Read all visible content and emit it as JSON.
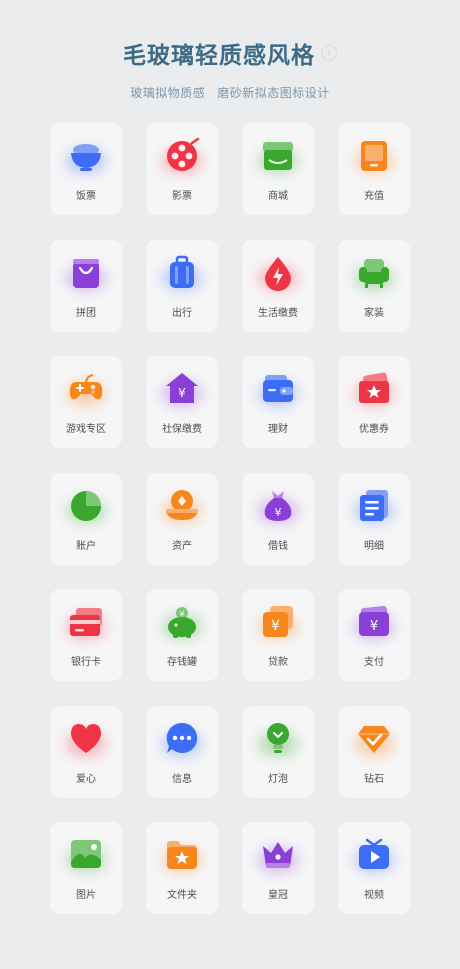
{
  "header": {
    "title": "毛玻璃轻质感风格",
    "badge": "!",
    "subtitle_1": "玻璃拟物质感",
    "subtitle_2": "磨砂新拟态图标设计"
  },
  "icons": [
    {
      "label": "饭票",
      "icon": "rice-bowl-icon",
      "color": "#3d6df5"
    },
    {
      "label": "影票",
      "icon": "film-reel-icon",
      "color": "#ee3546"
    },
    {
      "label": "商城",
      "icon": "shop-icon",
      "color": "#3aa72f"
    },
    {
      "label": "充值",
      "icon": "tablet-icon",
      "color": "#f7861d"
    },
    {
      "label": "拼团",
      "icon": "shopping-bag-icon",
      "color": "#8b3fd9"
    },
    {
      "label": "出行",
      "icon": "suitcase-icon",
      "color": "#3d6df5"
    },
    {
      "label": "生活缴费",
      "icon": "electricity-drop-icon",
      "color": "#ee3546"
    },
    {
      "label": "家装",
      "icon": "sofa-icon",
      "color": "#3aa72f"
    },
    {
      "label": "游戏专区",
      "icon": "gamepad-icon",
      "color": "#f7861d"
    },
    {
      "label": "社保缴费",
      "icon": "house-yuan-icon",
      "color": "#8b3fd9"
    },
    {
      "label": "理财",
      "icon": "wallet-icon",
      "color": "#3d6df5"
    },
    {
      "label": "优惠券",
      "icon": "coupon-star-icon",
      "color": "#ee3546"
    },
    {
      "label": "账户",
      "icon": "pie-chart-icon",
      "color": "#3aa72f"
    },
    {
      "label": "资产",
      "icon": "coin-tray-icon",
      "color": "#f7861d"
    },
    {
      "label": "借钱",
      "icon": "money-bag-icon",
      "color": "#8b3fd9"
    },
    {
      "label": "明细",
      "icon": "document-list-icon",
      "color": "#3d6df5"
    },
    {
      "label": "银行卡",
      "icon": "bank-card-icon",
      "color": "#ee3546"
    },
    {
      "label": "存钱罐",
      "icon": "piggy-bank-icon",
      "color": "#3aa72f"
    },
    {
      "label": "贷款",
      "icon": "loan-yuan-icon",
      "color": "#f7861d"
    },
    {
      "label": "支付",
      "icon": "payment-yuan-icon",
      "color": "#8b3fd9"
    },
    {
      "label": "爱心",
      "icon": "heart-icon",
      "color": "#ee3546"
    },
    {
      "label": "信息",
      "icon": "chat-bubble-icon",
      "color": "#3d6df5"
    },
    {
      "label": "灯泡",
      "icon": "light-bulb-icon",
      "color": "#3aa72f"
    },
    {
      "label": "钻石",
      "icon": "diamond-icon",
      "color": "#f7861d"
    },
    {
      "label": "图片",
      "icon": "picture-icon",
      "color": "#3aa72f"
    },
    {
      "label": "文件夹",
      "icon": "folder-star-icon",
      "color": "#f7861d"
    },
    {
      "label": "皇冠",
      "icon": "crown-icon",
      "color": "#8b3fd9"
    },
    {
      "label": "视频",
      "icon": "video-play-icon",
      "color": "#3d6df5"
    }
  ]
}
